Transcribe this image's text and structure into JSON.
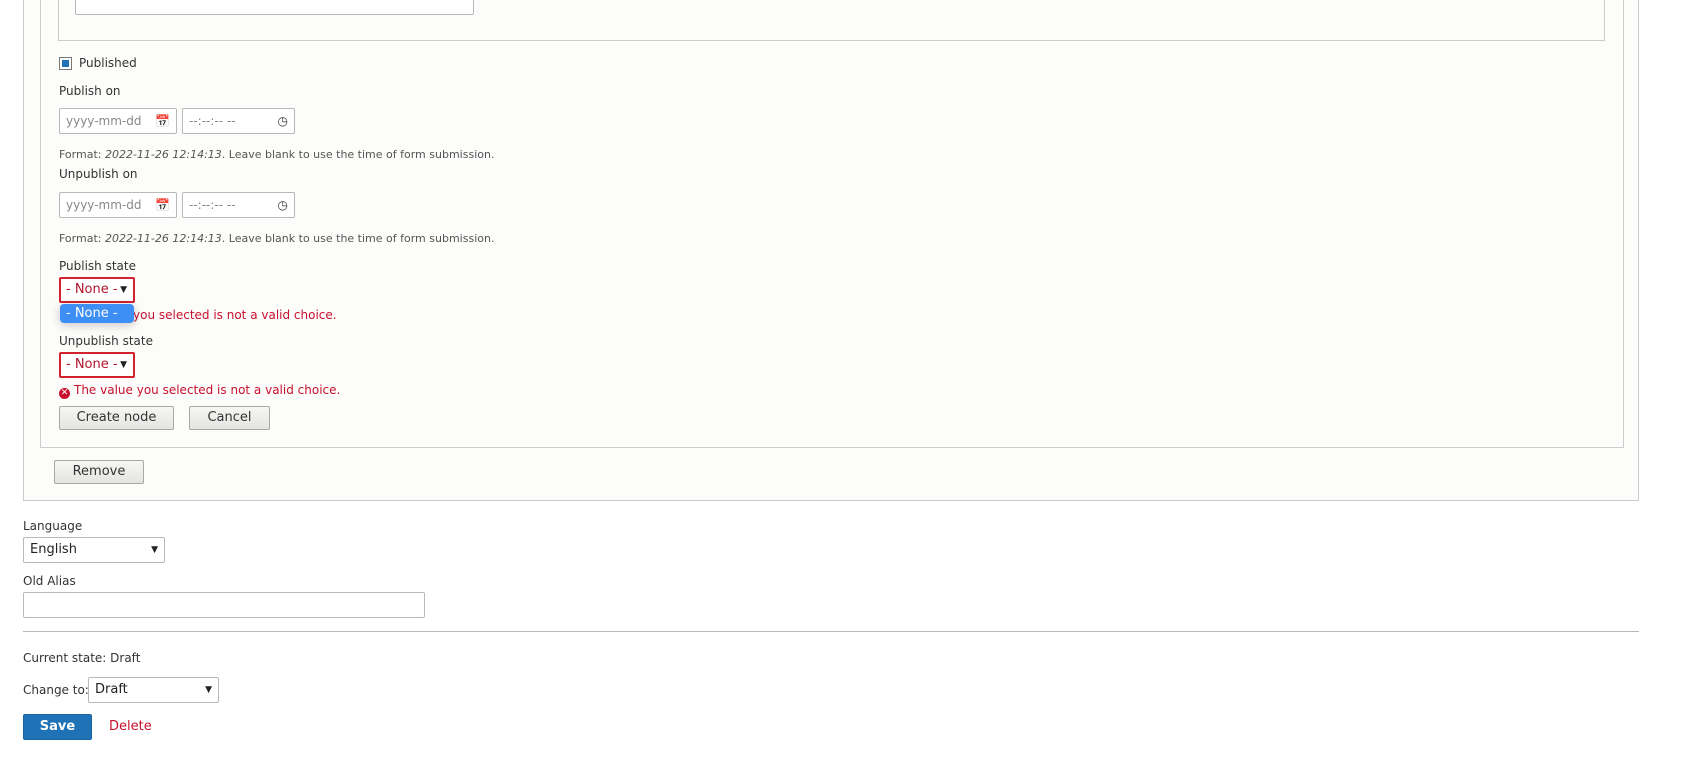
{
  "form": {
    "published_label": "Published",
    "publish_on": {
      "label": "Publish on",
      "date_placeholder": "yyyy-mm-dd",
      "time_placeholder": "--:--:-- --",
      "format_prefix": "Format: ",
      "format_example": "2022-11-26 12:14:13",
      "format_suffix": ". Leave blank to use the time of form submission."
    },
    "unpublish_on": {
      "label": "Unpublish on",
      "date_placeholder": "yyyy-mm-dd",
      "time_placeholder": "--:--:-- --",
      "format_prefix": "Format: ",
      "format_example": "2022-11-26 12:14:13",
      "format_suffix": ". Leave blank to use the time of form submission."
    },
    "publish_state": {
      "label": "Publish state",
      "selected": "- None -",
      "dropdown_option": "- None -",
      "error_visible": "you selected is not a valid choice."
    },
    "unpublish_state": {
      "label": "Unpublish state",
      "selected": "- None -",
      "error": "The value you selected is not a valid choice."
    },
    "create_node_label": "Create node",
    "cancel_label": "Cancel",
    "remove_label": "Remove"
  },
  "language": {
    "label": "Language",
    "selected": "English"
  },
  "old_alias": {
    "label": "Old Alias",
    "value": ""
  },
  "moderation": {
    "current_state_label": "Current state:",
    "current_state_value": "Draft",
    "change_to_label": "Change to:",
    "change_to_selected": "Draft"
  },
  "actions": {
    "save_label": "Save",
    "delete_label": "Delete"
  },
  "icons": {
    "calendar": "calendar-icon",
    "clock": "clock-icon",
    "caret": "caret-down-icon",
    "error": "error-icon"
  },
  "colors": {
    "primary": "#1f72b6",
    "error": "#c8102e",
    "dropdown_highlight": "#3d8ef5"
  }
}
